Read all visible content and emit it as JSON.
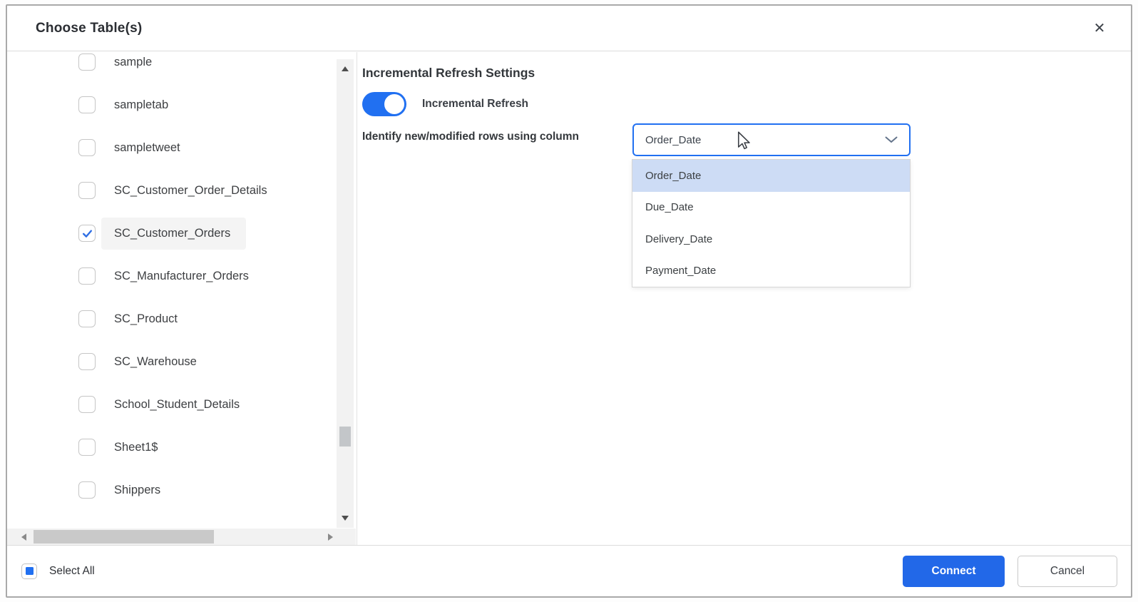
{
  "dialog": {
    "title": "Choose Table(s)",
    "close_icon": "✕"
  },
  "table_list": {
    "items": [
      {
        "label": "sample",
        "checked": false,
        "selected": false
      },
      {
        "label": "sampletab",
        "checked": false,
        "selected": false
      },
      {
        "label": "sampletweet",
        "checked": false,
        "selected": false
      },
      {
        "label": "SC_Customer_Order_Details",
        "checked": false,
        "selected": false
      },
      {
        "label": "SC_Customer_Orders",
        "checked": true,
        "selected": true
      },
      {
        "label": "SC_Manufacturer_Orders",
        "checked": false,
        "selected": false
      },
      {
        "label": "SC_Product",
        "checked": false,
        "selected": false
      },
      {
        "label": "SC_Warehouse",
        "checked": false,
        "selected": false
      },
      {
        "label": "School_Student_Details",
        "checked": false,
        "selected": false
      },
      {
        "label": "Sheet1$",
        "checked": false,
        "selected": false
      },
      {
        "label": "Shippers",
        "checked": false,
        "selected": false
      }
    ]
  },
  "settings": {
    "heading": "Incremental Refresh Settings",
    "toggle_label": "Incremental Refresh",
    "toggle_on": true,
    "column_label": "Identify new/modified rows using column",
    "dropdown": {
      "selected_value": "Order_Date",
      "highlighted_option": "Order_Date",
      "options": [
        "Order_Date",
        "Due_Date",
        "Delivery_Date",
        "Payment_Date"
      ]
    }
  },
  "footer": {
    "select_all_label": "Select All",
    "select_all_state": "indeterminate",
    "connect_label": "Connect",
    "cancel_label": "Cancel"
  },
  "colors": {
    "accent-blue": "#2170f1",
    "connect-blue": "#2268e8",
    "check-blue": "#2f6fe4",
    "selected-option-bg": "#cddcf5"
  }
}
